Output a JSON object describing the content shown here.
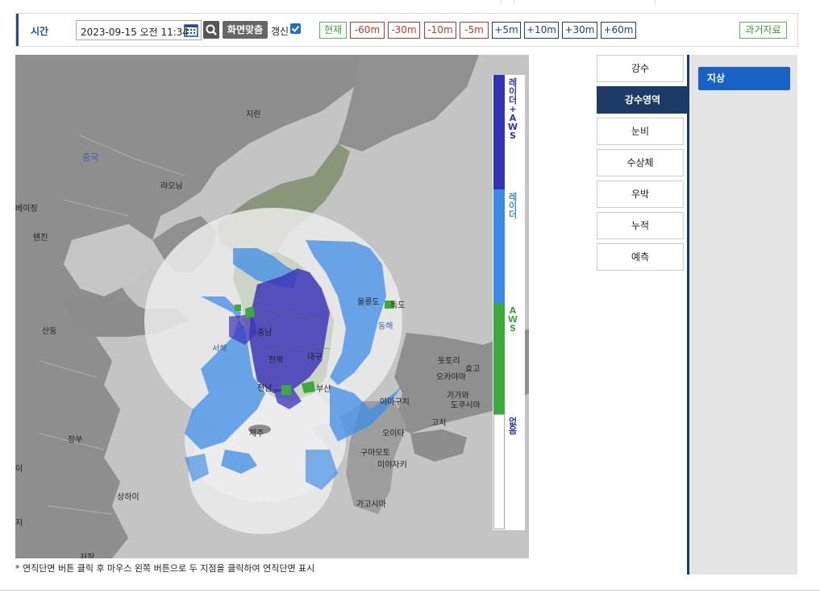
{
  "toolbar": {
    "label": "시간",
    "datetime": "2023-09-15 오전 11:34",
    "fit_label": "화면맞춤",
    "refresh_label": "갱신",
    "refresh_checked": true,
    "time_buttons": [
      "현재",
      "-60m",
      "-30m",
      "-10m",
      "-5m",
      "+5m",
      "+10m",
      "+30m",
      "+60m"
    ],
    "past_label": "과거자료"
  },
  "map": {
    "labels": {
      "china": "중국",
      "jilin": "지린",
      "liaoning": "랴오닝",
      "beijing": "베이징",
      "tianjin": "톈진",
      "shandong": "산둥",
      "jiangsu": "장쑤",
      "shanghai": "상하이",
      "jeju": "제주",
      "west_sea": "서해",
      "east_sea": "동해",
      "ulleung": "울릉도",
      "dokdo": "독도",
      "jeonbuk": "전북",
      "jeonnam": "전남",
      "chungnam": "충남",
      "daegu": "대구",
      "busan": "부산",
      "tottori": "돗토리",
      "hyogo": "효고",
      "okayama": "오카야마",
      "kagawa": "가가와",
      "tokushima": "도쿠시마",
      "kochi": "고치",
      "yamaguchi": "야마구치",
      "oita": "오이타",
      "kumamoto": "구마모토",
      "miyazaki": "미야자키",
      "kagoshima": "가고시마",
      "zhejiang": "저장",
      "edge_i": "이",
      "edge_ji": "지"
    }
  },
  "legend": {
    "items": [
      {
        "label": "레이더+AWS",
        "color": "#3232b4"
      },
      {
        "label": "레이더",
        "color": "#3c8ce6"
      },
      {
        "label": "AWS",
        "color": "#3caa3c"
      },
      {
        "label": "없음",
        "color": "#ffffff"
      }
    ]
  },
  "footnote": "* 연직단면 버튼 클릭 후 마우스 왼쪽 버튼으로 두 지점을 클릭하여 연직단면 표시",
  "side_menu": {
    "items": [
      "강수",
      "강수영역",
      "눈비",
      "수상체",
      "우박",
      "누적",
      "예측"
    ],
    "active_index": 1
  },
  "sub_menu": {
    "items": [
      "지상"
    ]
  },
  "colors": {
    "accent": "#1b3a66",
    "active_sub": "#1762c4",
    "minus": "#c0392b",
    "plus": "#1f3f7a",
    "now": "#5cb85c"
  }
}
